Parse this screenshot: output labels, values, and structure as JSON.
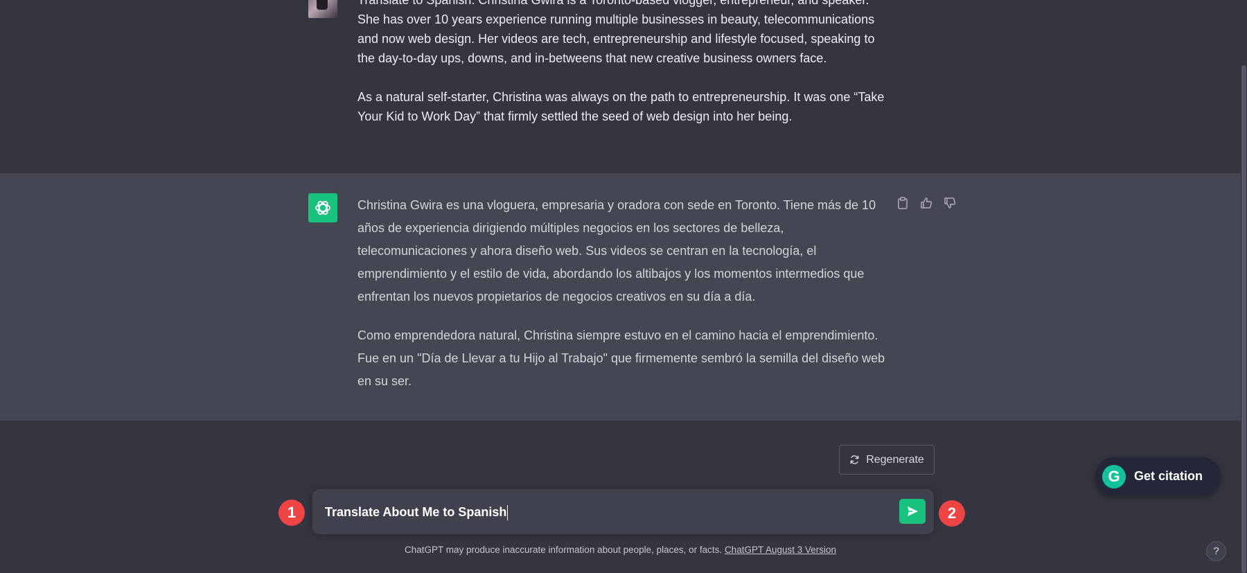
{
  "conversation": {
    "user_message": {
      "paragraphs": [
        "Translate to Spanish: Christina Gwira is a Toronto-based vlogger, entrepreneur, and speaker. She has over 10 years experience running multiple businesses in beauty, telecommunications and now web design. Her videos are tech, entrepreneurship and lifestyle focused, speaking to the day-to-day ups, downs, and in-betweens that new creative business owners face.",
        "As a natural self-starter, Christina was always on the path to entrepreneurship. It was one “Take Your Kid to Work Day” that firmly settled the seed of web design into her being."
      ]
    },
    "assistant_message": {
      "paragraphs": [
        "Christina Gwira es una vloguera, empresaria y oradora con sede en Toronto. Tiene más de 10 años de experiencia dirigiendo múltiples negocios en los sectores de belleza, telecomunicaciones y ahora diseño web. Sus videos se centran en la tecnología, el emprendimiento y el estilo de vida, abordando los altibajos y los momentos intermedios que enfrentan los nuevos propietarios de negocios creativos en su día a día.",
        "Como emprendedora natural, Christina siempre estuvo en el camino hacia el emprendimiento. Fue en un \"Día de Llevar a tu Hijo al Trabajo\" que firmemente sembró la semilla del diseño web en su ser."
      ]
    }
  },
  "regenerate": {
    "label": "Regenerate"
  },
  "composer": {
    "value": "Translate About Me to Spanish"
  },
  "markers": {
    "one": "1",
    "two": "2"
  },
  "footer": {
    "note": "ChatGPT may produce inaccurate information about people, places, or facts. ",
    "version_link": "ChatGPT August 3 Version"
  },
  "citation": {
    "label": "Get citation",
    "logo_letter": "G"
  },
  "help": {
    "label": "?"
  },
  "colors": {
    "background": "#343541",
    "assistant_background": "#444654",
    "accent_green": "#19c37d",
    "marker_red": "#ef4444"
  },
  "icons": {
    "sidebar_toggle": "sidebar-toggle-icon",
    "copy": "clipboard-icon",
    "thumbs_up": "thumbs-up-icon",
    "thumbs_down": "thumbs-down-icon",
    "regenerate": "refresh-icon",
    "send": "send-icon",
    "gpt_logo": "openai-logo-icon"
  }
}
